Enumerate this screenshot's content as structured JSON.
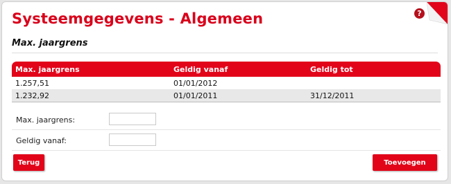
{
  "header": {
    "title": "Systeemgegevens - Algemeen",
    "help_icon": "?"
  },
  "section": {
    "title": "Max. jaargrens"
  },
  "table": {
    "columns": [
      "Max. jaargrens",
      "Geldig vanaf",
      "Geldig tot"
    ],
    "rows": [
      [
        "1.257,51",
        "01/01/2012",
        ""
      ],
      [
        "1.232,92",
        "01/01/2011",
        "31/12/2011"
      ]
    ]
  },
  "form": {
    "fields": [
      {
        "label": "Max. jaargrens:",
        "value": ""
      },
      {
        "label": "Geldig vanaf:",
        "value": ""
      }
    ]
  },
  "buttons": {
    "back": "Terug",
    "add": "Toevoegen"
  },
  "colors": {
    "accent": "#e2051a",
    "title": "#d9001b",
    "alt_row": "#e8e8e8"
  }
}
